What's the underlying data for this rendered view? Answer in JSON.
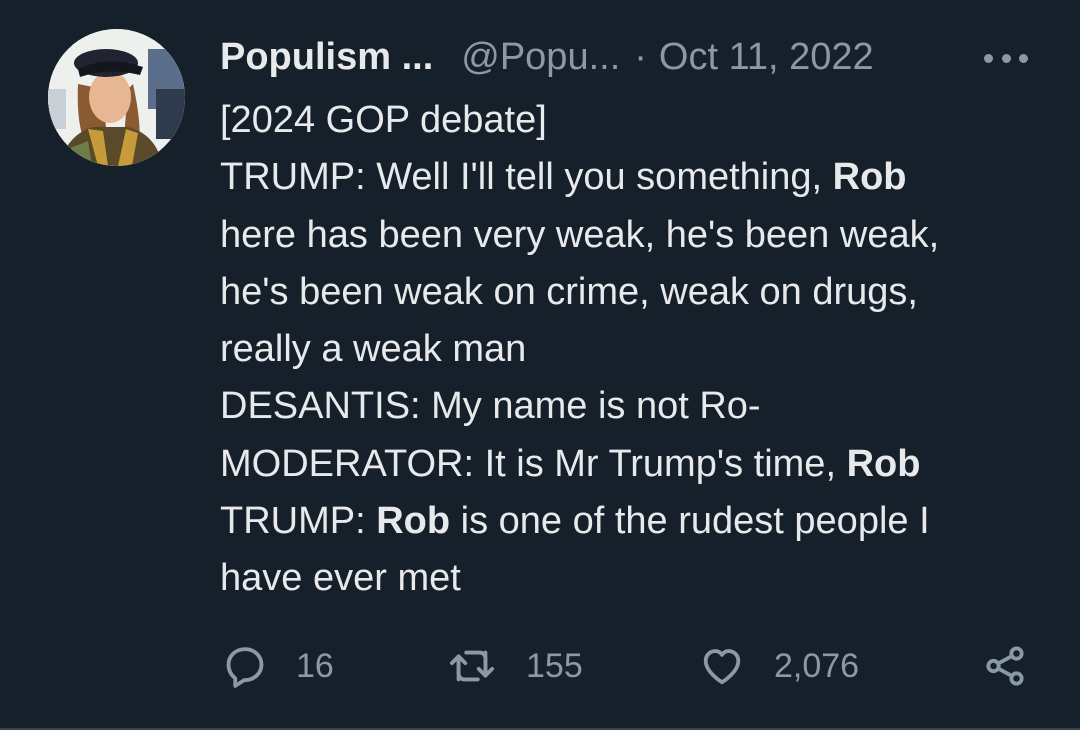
{
  "author": {
    "display_name": "Populism ...",
    "handle": "@Popu...",
    "separator": "·",
    "date": "Oct 11, 2022",
    "avatar_icon": "profile-photo"
  },
  "tweet": {
    "lines": [
      [
        {
          "t": "[2024 GOP debate]",
          "b": false
        }
      ],
      [
        {
          "t": "TRUMP: Well I'll tell you something, ",
          "b": false
        },
        {
          "t": "Rob",
          "b": true
        }
      ],
      [
        {
          "t": "here has been very weak, he's been weak,",
          "b": false
        }
      ],
      [
        {
          "t": "he's been weak on crime, weak on drugs,",
          "b": false
        }
      ],
      [
        {
          "t": "really a weak man",
          "b": false
        }
      ],
      [
        {
          "t": "DESANTIS: My name is not Ro-",
          "b": false
        }
      ],
      [
        {
          "t": "MODERATOR: It is Mr Trump's time, ",
          "b": false
        },
        {
          "t": "Rob",
          "b": true
        }
      ],
      [
        {
          "t": "TRUMP: ",
          "b": false
        },
        {
          "t": "Rob",
          "b": true
        },
        {
          "t": " is one of the rudest people I",
          "b": false
        }
      ],
      [
        {
          "t": "have ever met",
          "b": false
        }
      ]
    ]
  },
  "actions": {
    "replies": "16",
    "retweets": "155",
    "likes": "2,076",
    "icons": [
      "reply-icon",
      "retweet-icon",
      "like-icon",
      "share-icon"
    ]
  },
  "colors": {
    "background": "#15202b",
    "text": "#e7e9ea",
    "secondary": "#8b98a5"
  }
}
